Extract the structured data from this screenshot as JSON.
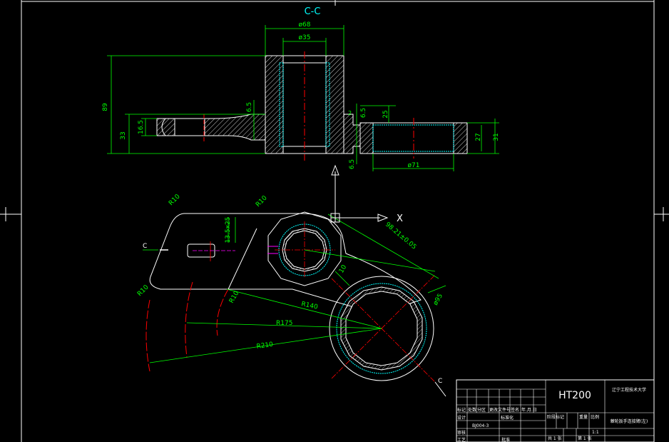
{
  "section_label": "C-C",
  "dims": {
    "d68": "ø68",
    "d35": "ø35",
    "h89": "89",
    "h33": "33",
    "h16_5": "16.5",
    "h6_5_a": "6.5",
    "h6_5_b": "6.5",
    "h6_5_c": "6.5",
    "h25": "25",
    "h27": "27",
    "h31": "31",
    "d71": "ø71",
    "r10_a": "R10",
    "r10_b": "R10",
    "r10_c": "R10",
    "r10_d": "R10",
    "slot": "13.5x25",
    "center_dist": "98.21±0.05",
    "w10": "10",
    "d95": "ø95",
    "r140": "R140",
    "r175": "R175",
    "r210": "R210",
    "c_left": "C",
    "c_right": "C"
  },
  "ucs": {
    "x_label": "X"
  },
  "title_block": {
    "material": "HT200",
    "school": "辽宁工程技术大学",
    "drawing_name": "棘轮扳手连接臂(左)",
    "designer": "设计",
    "checker": "审核",
    "process": "工艺",
    "approve": "批准",
    "scale": "1:1",
    "sheet_total": "共 1 张",
    "sheet_num": "第 1 张",
    "cols": [
      "标记",
      "处数",
      "分区",
      "更改文件号",
      "签名",
      "年.月.日"
    ],
    "stage_cols": [
      "阶段标记",
      "重量",
      "比例"
    ],
    "drawing_no": "BJ004-3",
    "std": "标准化"
  },
  "colors": {
    "outline": "#ffffff",
    "dimension": "#00ff00",
    "centerline": "#ff0000",
    "hatch": "#00ffff",
    "hidden": "#ff00ff",
    "background": "#000000"
  }
}
